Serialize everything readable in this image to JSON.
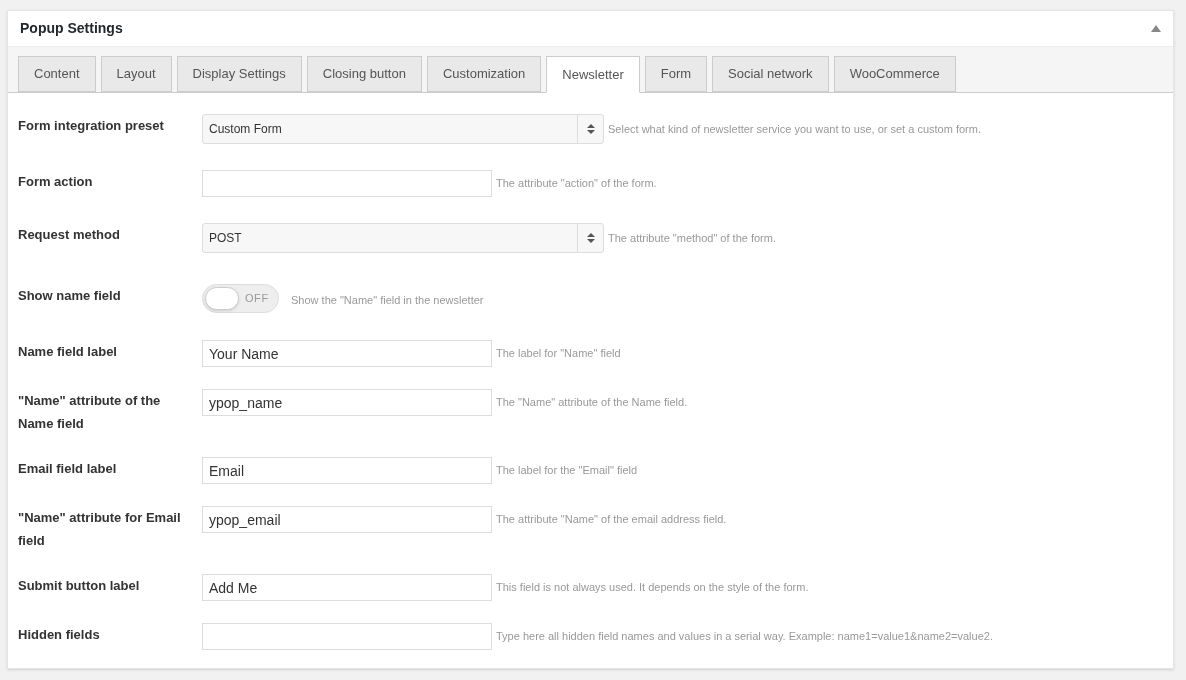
{
  "panel": {
    "title": "Popup Settings",
    "collapsed": false
  },
  "tabs": [
    {
      "label": "Content",
      "selected": false
    },
    {
      "label": "Layout",
      "selected": false
    },
    {
      "label": "Display Settings",
      "selected": false
    },
    {
      "label": "Closing button",
      "selected": false
    },
    {
      "label": "Customization",
      "selected": false
    },
    {
      "label": "Newsletter",
      "selected": true
    },
    {
      "label": "Form",
      "selected": false
    },
    {
      "label": "Social network",
      "selected": false
    },
    {
      "label": "WooCommerce",
      "selected": false
    }
  ],
  "fields": [
    {
      "kind": "select",
      "label": "Form integration preset",
      "value": "Custom Form",
      "hint": "Select what kind of newsletter service you want to use, or set a custom form."
    },
    {
      "kind": "text",
      "label": "Form action",
      "hint": "The attribute \"action\" of the form."
    },
    {
      "kind": "select",
      "label": "Request method",
      "value": "POST",
      "hint": "The attribute \"method\" of the form."
    },
    {
      "kind": "toggle",
      "label": "Show name field",
      "on": false,
      "state_text": "OFF",
      "hint": "Show the \"Name\" field in the newsletter"
    },
    {
      "kind": "text",
      "label": "Name field label",
      "value": "Your Name",
      "hint": "The label for \"Name\" field"
    },
    {
      "kind": "text",
      "label": "\"Name\" attribute of the Name field",
      "value": "ypop_name",
      "hint": "The \"Name\" attribute of the Name field."
    },
    {
      "kind": "text",
      "label": "Email field label",
      "value": "Email",
      "hint": "The label for the \"Email\" field"
    },
    {
      "kind": "text",
      "label": "\"Name\" attribute for Email field",
      "value": "ypop_email",
      "hint": "The attribute \"Name\" of the email address field."
    },
    {
      "kind": "text",
      "label": "Submit button label",
      "value": "Add Me",
      "hint": "This field is not always used. It depends on the style of the form."
    },
    {
      "kind": "text",
      "label": "Hidden fields",
      "hint": "Type here all hidden field names and values in a serial way. Example: name1=value1&name2=value2."
    }
  ]
}
